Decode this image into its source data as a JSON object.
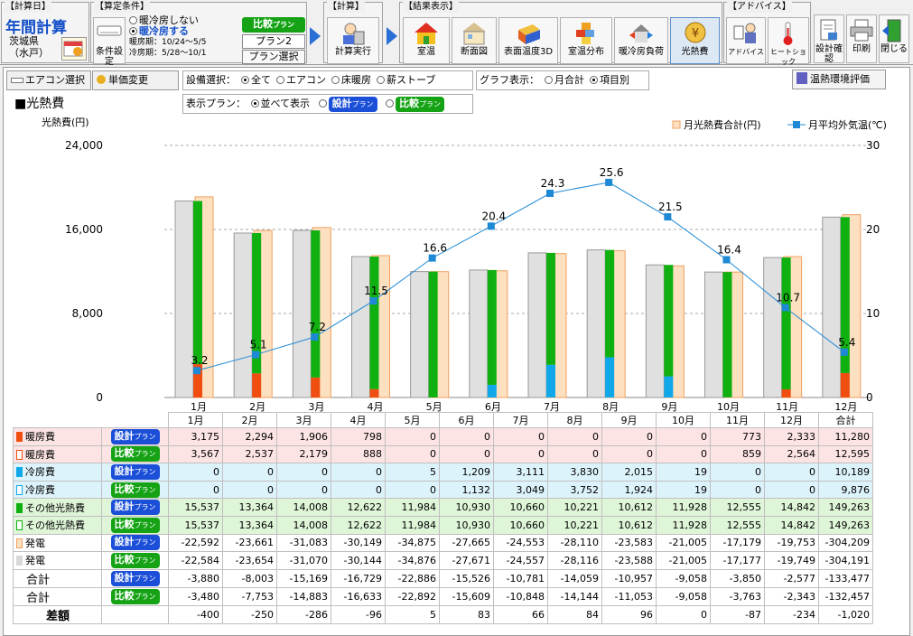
{
  "toolbar": {
    "groups": {
      "date": "【計算日】",
      "cond": "【算定条件】",
      "calc": "【計算】",
      "result": "【結果表示】",
      "advice": "【アドバイス】"
    },
    "calc_title": "年間計算",
    "location": "茨城県（水戸）",
    "cond_button": "条件設定",
    "ac_none": "暖冷房しない",
    "ac_on": "暖冷房する",
    "heating_period": "暖房期：10/24〜5/5",
    "cooling_period": "冷房期：5/28〜10/1",
    "compare_plan_label": "比較",
    "compare_plan_sub": "プラン",
    "plan_name": "プラン2",
    "plan_select": "プラン選択",
    "run": "計算実行",
    "results": [
      "室温",
      "断面図",
      "表面温度3D",
      "室温分布",
      "暖冷房負荷",
      "光熱費"
    ],
    "advice_buttons": [
      "アドバイス",
      "ヒートショック"
    ],
    "tools": [
      "設計確認",
      "印刷",
      "閉じる"
    ]
  },
  "controls": {
    "aircon_select": "エアコン選択",
    "unit_price": "単価変更",
    "equipment_label": "設備選択：",
    "equipment_options": [
      "全て",
      "エアコン",
      "床暖房",
      "薪ストーブ"
    ],
    "equipment_selected": "全て",
    "graph_label": "グラフ表示：",
    "graph_options": [
      "月合計",
      "項目別"
    ],
    "graph_selected": "項目別",
    "plan_display_label": "表示プラン：",
    "plan_display_option": "並べて表示",
    "design_label": "設計",
    "design_sub": "プラン",
    "compare_label": "比較",
    "compare_sub": "プラン",
    "env_eval": "温熱環境評価"
  },
  "section_title": "■光熱費",
  "colors": {
    "heating": "#f04d10",
    "cooling": "#10a8e8",
    "other": "#10b010",
    "generation": "#fde0c0",
    "generation_border": "#f0a060",
    "gray": "#e0e0e0",
    "line": "#1e8ad6"
  },
  "chart_data": {
    "type": "bar",
    "ylabel": "光熱費(円)",
    "ylim": [
      0,
      24000
    ],
    "yticks": [
      0,
      8000,
      16000,
      24000
    ],
    "y2lim": [
      0,
      30
    ],
    "y2ticks": [
      0,
      10,
      20,
      30
    ],
    "legend": [
      "月光熱費合計(円)",
      "月平均外気温(℃)"
    ],
    "categories": [
      "1月",
      "2月",
      "3月",
      "4月",
      "5月",
      "6月",
      "7月",
      "8月",
      "9月",
      "10月",
      "11月",
      "12月"
    ],
    "series": [
      {
        "name": "暖房費 設計",
        "values": [
          3175,
          2294,
          1906,
          798,
          0,
          0,
          0,
          0,
          0,
          0,
          773,
          2333
        ]
      },
      {
        "name": "暖房費 比較",
        "values": [
          3567,
          2537,
          2179,
          888,
          0,
          0,
          0,
          0,
          0,
          0,
          859,
          2564
        ]
      },
      {
        "name": "冷房費 設計",
        "values": [
          0,
          0,
          0,
          0,
          5,
          1209,
          3111,
          3830,
          2015,
          19,
          0,
          0
        ]
      },
      {
        "name": "冷房費 比較",
        "values": [
          0,
          0,
          0,
          0,
          0,
          1132,
          3049,
          3752,
          1924,
          19,
          0,
          0
        ]
      },
      {
        "name": "その他光熱費 設計",
        "values": [
          15537,
          13364,
          14008,
          12622,
          11984,
          10930,
          10660,
          10221,
          10612,
          11928,
          12555,
          14842
        ]
      },
      {
        "name": "その他光熱費 比較",
        "values": [
          15537,
          13364,
          14008,
          12622,
          11984,
          10930,
          10660,
          10221,
          10612,
          11928,
          12555,
          14842
        ]
      },
      {
        "name": "発電 設計",
        "values": [
          -22592,
          -23661,
          -31083,
          -30149,
          -34875,
          -27665,
          -24553,
          -28110,
          -23583,
          -21005,
          -17179,
          -19753
        ]
      },
      {
        "name": "発電 比較",
        "values": [
          -22584,
          -23654,
          -31070,
          -30144,
          -34876,
          -27671,
          -24557,
          -28116,
          -23588,
          -21005,
          -17177,
          -19749
        ]
      }
    ],
    "temperature": [
      3.2,
      5.1,
      7.2,
      11.5,
      16.6,
      20.4,
      24.3,
      25.6,
      21.5,
      16.4,
      10.7,
      5.4
    ]
  },
  "table": {
    "total_header": "合計",
    "rows": [
      {
        "label": "暖房費",
        "plan": "design",
        "color": "#f04d10",
        "fill": true,
        "bg": "#fde4e4",
        "values": [
          "3,175",
          "2,294",
          "1,906",
          "798",
          "0",
          "0",
          "0",
          "0",
          "0",
          "0",
          "773",
          "2,333",
          "11,280"
        ]
      },
      {
        "label": "暖房費",
        "plan": "compare",
        "color": "#f04d10",
        "fill": false,
        "bg": "#fde4e4",
        "values": [
          "3,567",
          "2,537",
          "2,179",
          "888",
          "0",
          "0",
          "0",
          "0",
          "0",
          "0",
          "859",
          "2,564",
          "12,595"
        ]
      },
      {
        "label": "冷房費",
        "plan": "design",
        "color": "#10a8e8",
        "fill": true,
        "bg": "#ddf3fb",
        "values": [
          "0",
          "0",
          "0",
          "0",
          "5",
          "1,209",
          "3,111",
          "3,830",
          "2,015",
          "19",
          "0",
          "0",
          "10,189"
        ]
      },
      {
        "label": "冷房費",
        "plan": "compare",
        "color": "#10a8e8",
        "fill": false,
        "bg": "#ddf3fb",
        "values": [
          "0",
          "0",
          "0",
          "0",
          "0",
          "1,132",
          "3,049",
          "3,752",
          "1,924",
          "19",
          "0",
          "0",
          "9,876"
        ]
      },
      {
        "label": "その他光熱費",
        "plan": "design",
        "color": "#10b010",
        "fill": true,
        "bg": "#dff5d8",
        "values": [
          "15,537",
          "13,364",
          "14,008",
          "12,622",
          "11,984",
          "10,930",
          "10,660",
          "10,221",
          "10,612",
          "11,928",
          "12,555",
          "14,842",
          "149,263"
        ]
      },
      {
        "label": "その他光熱費",
        "plan": "compare",
        "color": "#10b010",
        "fill": false,
        "bg": "#dff5d8",
        "values": [
          "15,537",
          "13,364",
          "14,008",
          "12,622",
          "11,984",
          "10,930",
          "10,660",
          "10,221",
          "10,612",
          "11,928",
          "12,555",
          "14,842",
          "149,263"
        ]
      },
      {
        "label": "発電",
        "plan": "design",
        "color": "#fde0c0",
        "fill": true,
        "bg": "#ffffff",
        "values": [
          "-22,592",
          "-23,661",
          "-31,083",
          "-30,149",
          "-34,875",
          "-27,665",
          "-24,553",
          "-28,110",
          "-23,583",
          "-21,005",
          "-17,179",
          "-19,753",
          "-304,209"
        ]
      },
      {
        "label": "発電",
        "plan": "compare",
        "color": "#d8d8d8",
        "fill": true,
        "bg": "#ffffff",
        "values": [
          "-22,584",
          "-23,654",
          "-31,070",
          "-30,144",
          "-34,876",
          "-27,671",
          "-24,557",
          "-28,116",
          "-23,588",
          "-21,005",
          "-17,177",
          "-19,749",
          "-304,191"
        ]
      },
      {
        "label": "合計",
        "plan": "design",
        "color": "",
        "fill": false,
        "bg": "#ffffff",
        "values": [
          "-3,880",
          "-8,003",
          "-15,169",
          "-16,729",
          "-22,886",
          "-15,526",
          "-10,781",
          "-14,059",
          "-10,957",
          "-9,058",
          "-3,850",
          "-2,577",
          "-133,477"
        ]
      },
      {
        "label": "合計",
        "plan": "compare",
        "color": "",
        "fill": false,
        "bg": "#ffffff",
        "values": [
          "-3,480",
          "-7,753",
          "-14,883",
          "-16,633",
          "-22,892",
          "-15,609",
          "-10,848",
          "-14,144",
          "-11,053",
          "-9,058",
          "-3,763",
          "-2,343",
          "-132,457"
        ]
      },
      {
        "label": "差額",
        "plan": "",
        "color": "",
        "fill": false,
        "bg": "#ffffff",
        "values": [
          "-400",
          "-250",
          "-286",
          "-96",
          "5",
          "83",
          "66",
          "84",
          "96",
          "0",
          "-87",
          "-234",
          "-1,020"
        ]
      }
    ]
  }
}
